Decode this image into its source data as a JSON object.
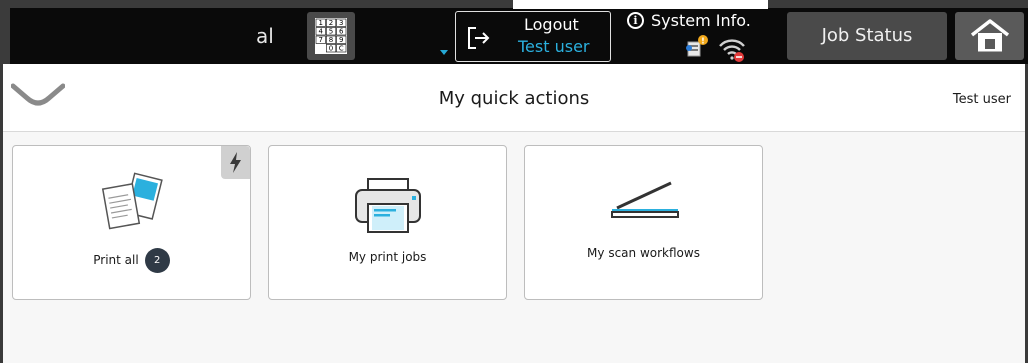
{
  "topbar": {
    "input_text": "al",
    "logout": {
      "label": "Logout",
      "user": "Test user"
    },
    "system_info": {
      "icon_glyph": "i",
      "label": "System Info."
    },
    "job_status_label": "Job Status",
    "keypad_keys": [
      "1",
      "2",
      "3",
      "4",
      "5",
      "6",
      "7",
      "8",
      "9",
      "",
      "0",
      "C"
    ]
  },
  "header": {
    "title": "My quick actions",
    "user": "Test user"
  },
  "tiles": [
    {
      "label": "Print all",
      "count": "2",
      "icon": "documents-icon",
      "has_flash": true
    },
    {
      "label": "My print jobs",
      "icon": "printer-icon"
    },
    {
      "label": "My scan workflows",
      "icon": "scanner-icon"
    }
  ],
  "colors": {
    "accent": "#2bb0de",
    "badge": "#2f3a46",
    "topbar": "#0a0a0a"
  }
}
